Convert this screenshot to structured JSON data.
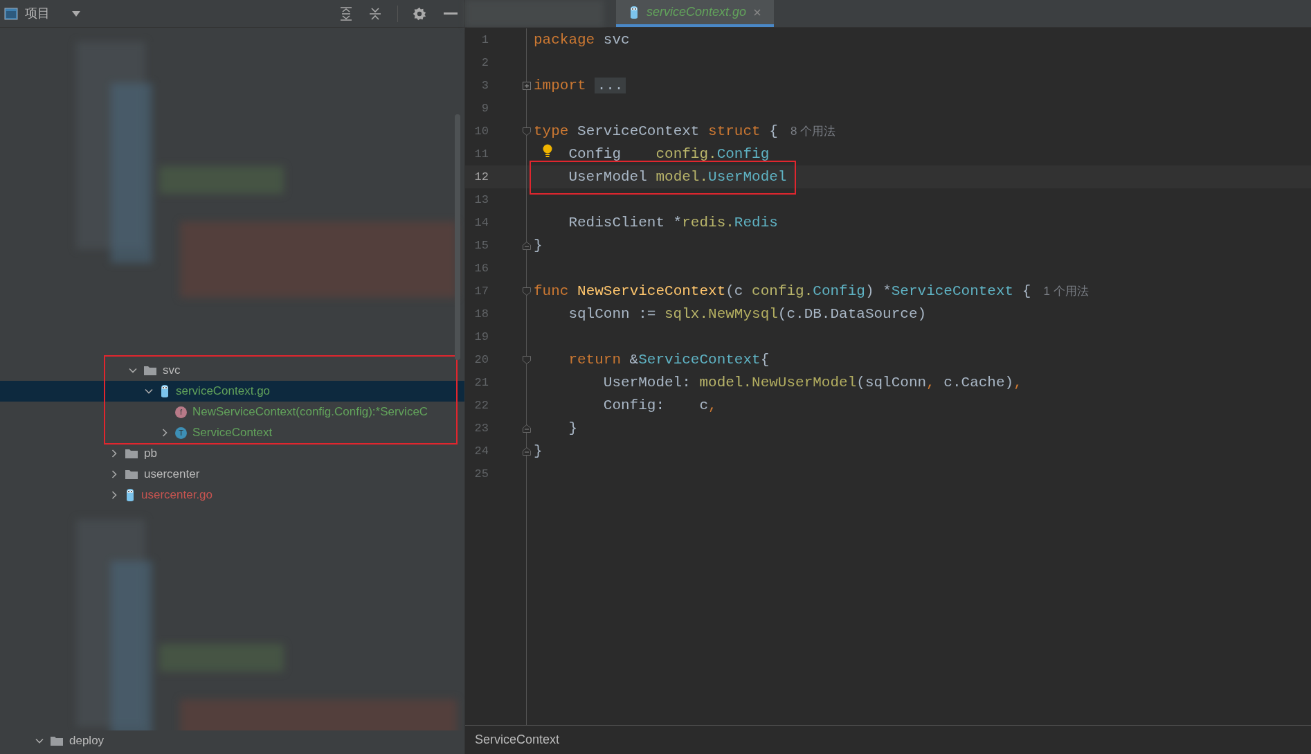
{
  "project_panel": {
    "title": "项目",
    "nested_tree": [
      {
        "name": "svc",
        "kind": "folder",
        "expanded": true,
        "selected": false,
        "color": "#bbbbbb",
        "annotated": true,
        "children": [
          {
            "name": "serviceContext.go",
            "kind": "go-file",
            "expanded": true,
            "selected": true,
            "color": "#62a35b",
            "children": [
              {
                "name": "NewServiceContext(config.Config):*ServiceC",
                "kind": "function",
                "badge": "f",
                "selected": false,
                "color": "#62a35b"
              },
              {
                "name": "ServiceContext",
                "kind": "type",
                "badge": "T",
                "expanded": false,
                "selected": false,
                "color": "#62a35b"
              }
            ]
          }
        ]
      }
    ],
    "tree": [
      {
        "name": "pb",
        "kind": "folder",
        "expanded": false,
        "selected": false,
        "color": "#bbbbbb"
      },
      {
        "name": "usercenter",
        "kind": "folder",
        "expanded": false,
        "selected": false,
        "color": "#bbbbbb"
      },
      {
        "name": "usercenter.go",
        "kind": "go-file",
        "expanded": false,
        "selected": false,
        "color": "#c75450"
      }
    ],
    "bottom_tree": [
      {
        "name": "deploy",
        "kind": "folder",
        "expanded": true,
        "selected": false,
        "color": "#bbbbbb"
      }
    ]
  },
  "editor": {
    "tabs": [
      {
        "kind": "obscured",
        "selected": false
      },
      {
        "kind": "go-file",
        "label": "serviceContext.go",
        "selected": true
      }
    ],
    "lines": [
      {
        "number": "1",
        "tokens": [
          {
            "kind": "keyword",
            "text": "package"
          },
          {
            "kind": "plain",
            "text": " svc"
          }
        ]
      },
      {
        "number": "2"
      },
      {
        "number": "3",
        "folded": true,
        "tokens": [
          {
            "kind": "keyword",
            "text": "import"
          },
          {
            "kind": "folded",
            "text": "..."
          }
        ]
      },
      {
        "number": "9"
      },
      {
        "number": "10",
        "fold_start": true,
        "tokens": [
          {
            "kind": "keyword",
            "text": "type"
          },
          {
            "kind": "plain",
            "text": " ServiceContext "
          },
          {
            "kind": "keyword",
            "text": "struct"
          },
          {
            "kind": "plain",
            "text": " {"
          }
        ],
        "hint": "8 个用法"
      },
      {
        "number": "11",
        "bulb": true,
        "tokens": [
          {
            "kind": "plain",
            "text": "    Config    "
          },
          {
            "kind": "package",
            "text": "config."
          },
          {
            "kind": "type",
            "text": "Config"
          }
        ]
      },
      {
        "number": "12",
        "current": true,
        "annotated": true,
        "tokens": [
          {
            "kind": "plain",
            "text": "    UserModel "
          },
          {
            "kind": "package",
            "text": "model."
          },
          {
            "kind": "type",
            "text": "UserModel"
          }
        ]
      },
      {
        "number": "13"
      },
      {
        "number": "14",
        "tokens": [
          {
            "kind": "plain",
            "text": "    RedisClient *"
          },
          {
            "kind": "package",
            "text": "redis."
          },
          {
            "kind": "type",
            "text": "Redis"
          }
        ]
      },
      {
        "number": "15",
        "fold_end": true,
        "tokens": [
          {
            "kind": "plain",
            "text": "}"
          }
        ]
      },
      {
        "number": "16"
      },
      {
        "number": "17",
        "fold_start": true,
        "tokens": [
          {
            "kind": "keyword",
            "text": "func"
          },
          {
            "kind": "function",
            "text": " NewServiceContext"
          },
          {
            "kind": "plain",
            "text": "(c "
          },
          {
            "kind": "package",
            "text": "config."
          },
          {
            "kind": "type",
            "text": "Config"
          },
          {
            "kind": "plain",
            "text": ") *"
          },
          {
            "kind": "type",
            "text": "ServiceContext"
          },
          {
            "kind": "plain",
            "text": " {"
          }
        ],
        "hint": "1 个用法"
      },
      {
        "number": "18",
        "tokens": [
          {
            "kind": "plain",
            "text": "    sqlConn := "
          },
          {
            "kind": "package",
            "text": "sqlx."
          },
          {
            "kind": "call",
            "text": "NewMysql"
          },
          {
            "kind": "plain",
            "text": "(c.DB.DataSource)"
          }
        ]
      },
      {
        "number": "19"
      },
      {
        "number": "20",
        "fold_start": true,
        "tokens": [
          {
            "kind": "keyword",
            "text": "    return"
          },
          {
            "kind": "plain",
            "text": " &"
          },
          {
            "kind": "type",
            "text": "ServiceContext"
          },
          {
            "kind": "plain",
            "text": "{"
          }
        ]
      },
      {
        "number": "21",
        "tokens": [
          {
            "kind": "plain",
            "text": "        UserModel: "
          },
          {
            "kind": "package",
            "text": "model."
          },
          {
            "kind": "call",
            "text": "NewUserModel"
          },
          {
            "kind": "plain",
            "text": "(sqlConn"
          },
          {
            "kind": "punct",
            "text": ","
          },
          {
            "kind": "plain",
            "text": " c.Cache)"
          },
          {
            "kind": "punct",
            "text": ","
          }
        ]
      },
      {
        "number": "22",
        "tokens": [
          {
            "kind": "plain",
            "text": "        Config:    c"
          },
          {
            "kind": "punct",
            "text": ","
          }
        ]
      },
      {
        "number": "23",
        "fold_end": true,
        "tokens": [
          {
            "kind": "plain",
            "text": "    }"
          }
        ]
      },
      {
        "number": "24",
        "fold_end": true,
        "tokens": [
          {
            "kind": "plain",
            "text": "}"
          }
        ]
      },
      {
        "number": "25"
      }
    ]
  },
  "breadcrumb": "ServiceContext"
}
